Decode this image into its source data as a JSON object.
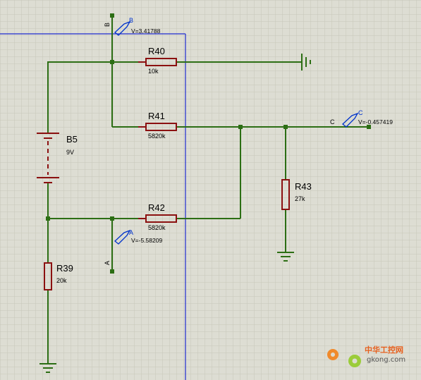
{
  "components": {
    "R40": {
      "name": "R40",
      "value": "10k"
    },
    "R41": {
      "name": "R41",
      "value": "5820k"
    },
    "R42": {
      "name": "R42",
      "value": "5820k"
    },
    "R43": {
      "name": "R43",
      "value": "27k"
    },
    "R39": {
      "name": "R39",
      "value": "20k"
    },
    "B5": {
      "name": "B5",
      "value": "9V"
    }
  },
  "probes": {
    "A": {
      "label": "A",
      "reading": "V=-5.58209",
      "terminal": "A"
    },
    "B": {
      "label": "B",
      "reading": "V=3.41788",
      "terminal": "B"
    },
    "C": {
      "label": "C",
      "reading": "V=-0.457419",
      "terminal": "C"
    }
  },
  "colors": {
    "background": "#ddddd3",
    "grid": "#c8c8bc",
    "wire": "#2c6e14",
    "component": "#8b1010",
    "sheet_border": "#1f2bd0",
    "probe_text": "#0033cc"
  },
  "watermark": {
    "line1": "中华工控网",
    "line2": "gkong.com"
  }
}
